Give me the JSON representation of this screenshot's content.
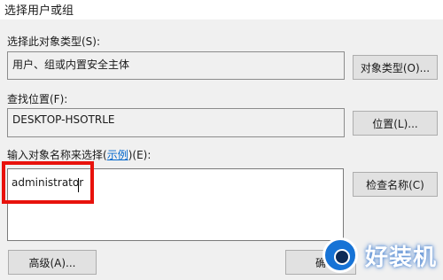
{
  "window": {
    "title": "选择用户或组"
  },
  "object_type": {
    "label": "选择此对象类型(S):",
    "value": "用户、组或内置安全主体",
    "button": "对象类型(O)..."
  },
  "location": {
    "label": "查找位置(F):",
    "value": "DESKTOP-HSOTRLE",
    "button": "位置(L)..."
  },
  "names": {
    "label_prefix": "输入对象名称来选择(",
    "label_link": "示例",
    "label_suffix": ")(E):",
    "value": "administrator",
    "check_button": "检查名称(C)"
  },
  "footer": {
    "advanced_button": "高级(A)...",
    "ok_button": "确"
  },
  "watermark": {
    "text": "好装机"
  },
  "colors": {
    "highlight": "#e8120c",
    "link": "#0066cc"
  }
}
